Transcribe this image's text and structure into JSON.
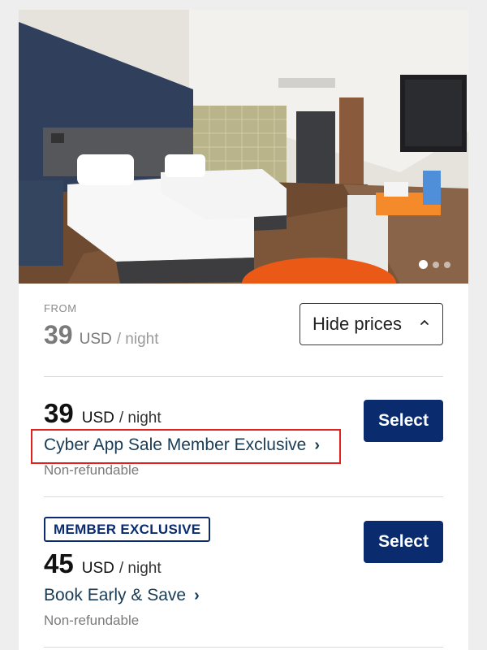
{
  "photo": {
    "slide_count": 3,
    "active_slide": 1
  },
  "summary": {
    "from_label": "FROM",
    "price": "39",
    "currency": "USD",
    "per_night": "/ night",
    "hide_prices_label": "Hide prices",
    "hide_prices_icon": "chevron-up-icon"
  },
  "rates": [
    {
      "price": "39",
      "currency": "USD",
      "per_night": "/ night",
      "name": "Cyber App Sale Member Exclusive",
      "policy": "Non-refundable",
      "select_label": "Select",
      "badge": ""
    },
    {
      "price": "45",
      "currency": "USD",
      "per_night": "/ night",
      "name": "Book Early & Save",
      "policy": "Non-refundable",
      "select_label": "Select",
      "badge": "MEMBER EXCLUSIVE"
    }
  ],
  "colors": {
    "primary": "#0a2c6e",
    "link": "#183b56",
    "highlight": "#e0231f"
  }
}
